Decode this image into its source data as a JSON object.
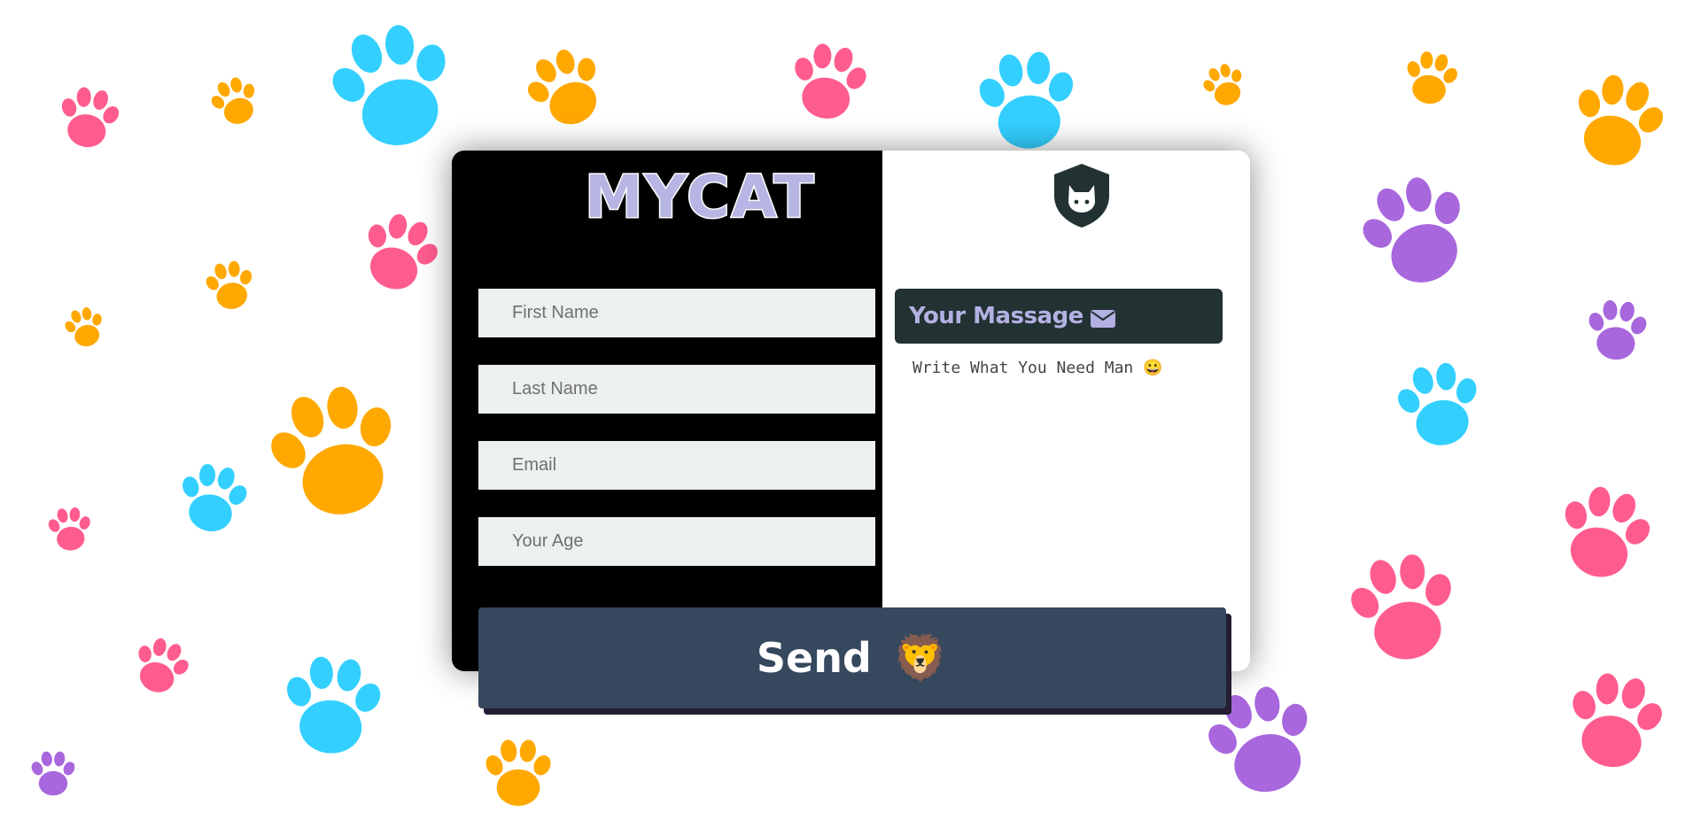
{
  "background": {
    "icon": "paw-print-icon",
    "colors": {
      "pink": "#ff5c8e",
      "orange": "#ffa800",
      "cyan": "#33d0ff",
      "purple": "#a867dd"
    }
  },
  "card": {
    "logo": "MYCAT",
    "form": {
      "first_name_placeholder": "First Name",
      "last_name_placeholder": "Last Name",
      "email_placeholder": "Email",
      "age_placeholder": "Your Age"
    },
    "side": {
      "shield_icon": "cat-shield-icon",
      "message_title": "Your Massage",
      "message_icon": "envelope-icon",
      "message_placeholder": "Write What You Need Man 😀"
    },
    "send": {
      "label": "Send",
      "emoji": "🦁"
    }
  },
  "colors": {
    "logo": "#b7b5e3",
    "panel_dark": "#000000",
    "message_header_bg": "#223132",
    "message_header_text": "#b3b1e3",
    "send_bg": "#35485e",
    "send_shadow": "#241d33",
    "input_bg": "#ecf0f1"
  }
}
